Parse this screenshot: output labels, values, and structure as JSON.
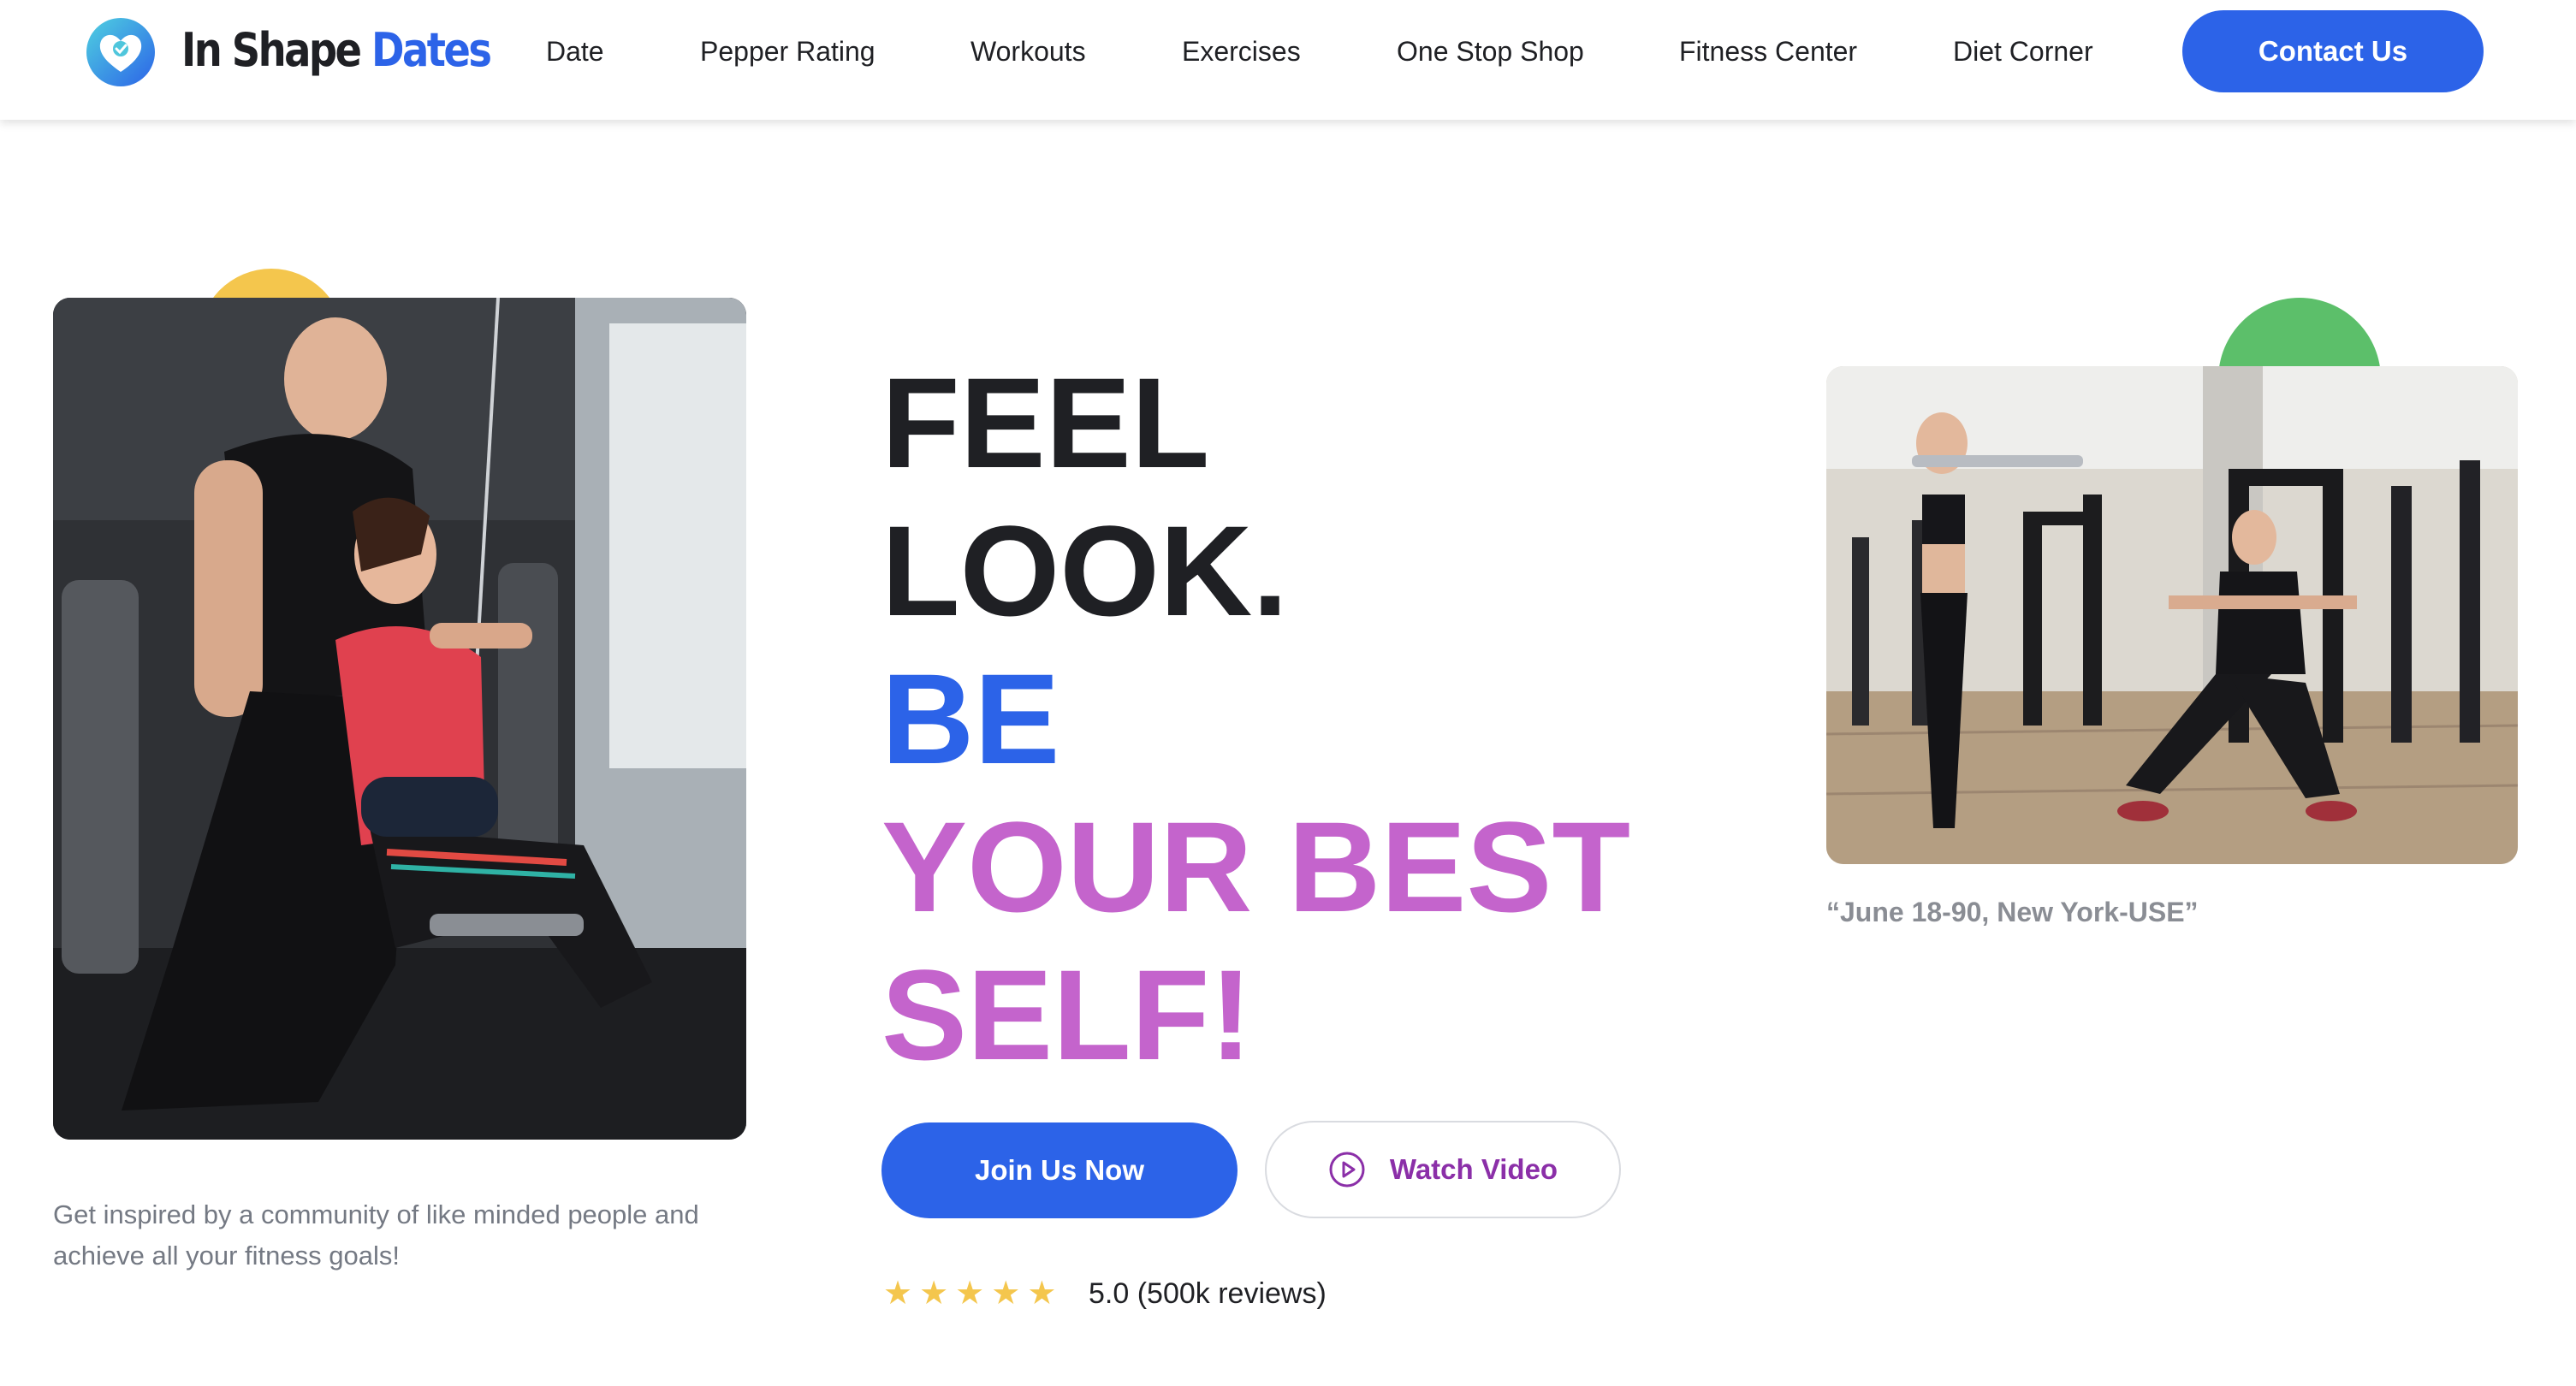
{
  "brand": {
    "name_part1": "In Shape",
    "name_part2": "Dates",
    "logo_icon": "heart-badge-icon",
    "colors": {
      "blue": "#2c63e8",
      "dark": "#1f2024"
    }
  },
  "nav": {
    "items": [
      {
        "label": "Date"
      },
      {
        "label": "Pepper Rating"
      },
      {
        "label": "Workouts"
      },
      {
        "label": "Exercises"
      },
      {
        "label": "One Stop Shop"
      },
      {
        "label": "Fitness Center"
      },
      {
        "label": "Diet Corner"
      }
    ],
    "contact_label": "Contact Us"
  },
  "hero": {
    "headline": {
      "line1": "FEEL",
      "line2": "LOOK.",
      "line3": "BE",
      "line4": "YOUR BEST",
      "line5": "SELF!"
    },
    "colors": {
      "blue": "#2c63e8",
      "purple": "#c464cc",
      "yellow": "#f4c64d",
      "green": "#5cbf6a"
    },
    "join_label": "Join Us Now",
    "watch_label": "Watch Video",
    "watch_icon": "play-circle-icon",
    "rating": {
      "stars": 5,
      "text": "5.0 (500k reviews)"
    },
    "left_caption": "Get inspired by a community of like minded people and achieve all your fitness goals!",
    "right_caption": "“June 18-90, New York-USE”"
  }
}
